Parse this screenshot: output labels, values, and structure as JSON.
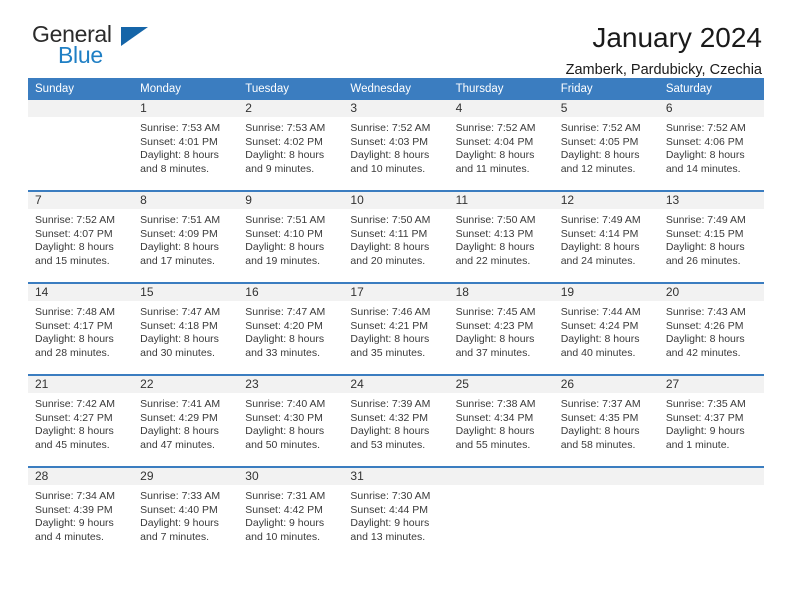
{
  "brand": {
    "name_part1": "General",
    "name_part2": "Blue",
    "accent_color": "#1f7fc4",
    "triangle_color": "#1565a8"
  },
  "header": {
    "title": "January 2024",
    "subtitle": "Zamberk, Pardubicky, Czechia"
  },
  "calendar": {
    "header_color": "#3b7dc0",
    "weekday_headers": [
      "Sunday",
      "Monday",
      "Tuesday",
      "Wednesday",
      "Thursday",
      "Friday",
      "Saturday"
    ],
    "weeks": [
      [
        {
          "day": "",
          "sunrise": "",
          "sunset": "",
          "daylight1": "",
          "daylight2": ""
        },
        {
          "day": "1",
          "sunrise": "Sunrise: 7:53 AM",
          "sunset": "Sunset: 4:01 PM",
          "daylight1": "Daylight: 8 hours",
          "daylight2": "and 8 minutes."
        },
        {
          "day": "2",
          "sunrise": "Sunrise: 7:53 AM",
          "sunset": "Sunset: 4:02 PM",
          "daylight1": "Daylight: 8 hours",
          "daylight2": "and 9 minutes."
        },
        {
          "day": "3",
          "sunrise": "Sunrise: 7:52 AM",
          "sunset": "Sunset: 4:03 PM",
          "daylight1": "Daylight: 8 hours",
          "daylight2": "and 10 minutes."
        },
        {
          "day": "4",
          "sunrise": "Sunrise: 7:52 AM",
          "sunset": "Sunset: 4:04 PM",
          "daylight1": "Daylight: 8 hours",
          "daylight2": "and 11 minutes."
        },
        {
          "day": "5",
          "sunrise": "Sunrise: 7:52 AM",
          "sunset": "Sunset: 4:05 PM",
          "daylight1": "Daylight: 8 hours",
          "daylight2": "and 12 minutes."
        },
        {
          "day": "6",
          "sunrise": "Sunrise: 7:52 AM",
          "sunset": "Sunset: 4:06 PM",
          "daylight1": "Daylight: 8 hours",
          "daylight2": "and 14 minutes."
        }
      ],
      [
        {
          "day": "7",
          "sunrise": "Sunrise: 7:52 AM",
          "sunset": "Sunset: 4:07 PM",
          "daylight1": "Daylight: 8 hours",
          "daylight2": "and 15 minutes."
        },
        {
          "day": "8",
          "sunrise": "Sunrise: 7:51 AM",
          "sunset": "Sunset: 4:09 PM",
          "daylight1": "Daylight: 8 hours",
          "daylight2": "and 17 minutes."
        },
        {
          "day": "9",
          "sunrise": "Sunrise: 7:51 AM",
          "sunset": "Sunset: 4:10 PM",
          "daylight1": "Daylight: 8 hours",
          "daylight2": "and 19 minutes."
        },
        {
          "day": "10",
          "sunrise": "Sunrise: 7:50 AM",
          "sunset": "Sunset: 4:11 PM",
          "daylight1": "Daylight: 8 hours",
          "daylight2": "and 20 minutes."
        },
        {
          "day": "11",
          "sunrise": "Sunrise: 7:50 AM",
          "sunset": "Sunset: 4:13 PM",
          "daylight1": "Daylight: 8 hours",
          "daylight2": "and 22 minutes."
        },
        {
          "day": "12",
          "sunrise": "Sunrise: 7:49 AM",
          "sunset": "Sunset: 4:14 PM",
          "daylight1": "Daylight: 8 hours",
          "daylight2": "and 24 minutes."
        },
        {
          "day": "13",
          "sunrise": "Sunrise: 7:49 AM",
          "sunset": "Sunset: 4:15 PM",
          "daylight1": "Daylight: 8 hours",
          "daylight2": "and 26 minutes."
        }
      ],
      [
        {
          "day": "14",
          "sunrise": "Sunrise: 7:48 AM",
          "sunset": "Sunset: 4:17 PM",
          "daylight1": "Daylight: 8 hours",
          "daylight2": "and 28 minutes."
        },
        {
          "day": "15",
          "sunrise": "Sunrise: 7:47 AM",
          "sunset": "Sunset: 4:18 PM",
          "daylight1": "Daylight: 8 hours",
          "daylight2": "and 30 minutes."
        },
        {
          "day": "16",
          "sunrise": "Sunrise: 7:47 AM",
          "sunset": "Sunset: 4:20 PM",
          "daylight1": "Daylight: 8 hours",
          "daylight2": "and 33 minutes."
        },
        {
          "day": "17",
          "sunrise": "Sunrise: 7:46 AM",
          "sunset": "Sunset: 4:21 PM",
          "daylight1": "Daylight: 8 hours",
          "daylight2": "and 35 minutes."
        },
        {
          "day": "18",
          "sunrise": "Sunrise: 7:45 AM",
          "sunset": "Sunset: 4:23 PM",
          "daylight1": "Daylight: 8 hours",
          "daylight2": "and 37 minutes."
        },
        {
          "day": "19",
          "sunrise": "Sunrise: 7:44 AM",
          "sunset": "Sunset: 4:24 PM",
          "daylight1": "Daylight: 8 hours",
          "daylight2": "and 40 minutes."
        },
        {
          "day": "20",
          "sunrise": "Sunrise: 7:43 AM",
          "sunset": "Sunset: 4:26 PM",
          "daylight1": "Daylight: 8 hours",
          "daylight2": "and 42 minutes."
        }
      ],
      [
        {
          "day": "21",
          "sunrise": "Sunrise: 7:42 AM",
          "sunset": "Sunset: 4:27 PM",
          "daylight1": "Daylight: 8 hours",
          "daylight2": "and 45 minutes."
        },
        {
          "day": "22",
          "sunrise": "Sunrise: 7:41 AM",
          "sunset": "Sunset: 4:29 PM",
          "daylight1": "Daylight: 8 hours",
          "daylight2": "and 47 minutes."
        },
        {
          "day": "23",
          "sunrise": "Sunrise: 7:40 AM",
          "sunset": "Sunset: 4:30 PM",
          "daylight1": "Daylight: 8 hours",
          "daylight2": "and 50 minutes."
        },
        {
          "day": "24",
          "sunrise": "Sunrise: 7:39 AM",
          "sunset": "Sunset: 4:32 PM",
          "daylight1": "Daylight: 8 hours",
          "daylight2": "and 53 minutes."
        },
        {
          "day": "25",
          "sunrise": "Sunrise: 7:38 AM",
          "sunset": "Sunset: 4:34 PM",
          "daylight1": "Daylight: 8 hours",
          "daylight2": "and 55 minutes."
        },
        {
          "day": "26",
          "sunrise": "Sunrise: 7:37 AM",
          "sunset": "Sunset: 4:35 PM",
          "daylight1": "Daylight: 8 hours",
          "daylight2": "and 58 minutes."
        },
        {
          "day": "27",
          "sunrise": "Sunrise: 7:35 AM",
          "sunset": "Sunset: 4:37 PM",
          "daylight1": "Daylight: 9 hours",
          "daylight2": "and 1 minute."
        }
      ],
      [
        {
          "day": "28",
          "sunrise": "Sunrise: 7:34 AM",
          "sunset": "Sunset: 4:39 PM",
          "daylight1": "Daylight: 9 hours",
          "daylight2": "and 4 minutes."
        },
        {
          "day": "29",
          "sunrise": "Sunrise: 7:33 AM",
          "sunset": "Sunset: 4:40 PM",
          "daylight1": "Daylight: 9 hours",
          "daylight2": "and 7 minutes."
        },
        {
          "day": "30",
          "sunrise": "Sunrise: 7:31 AM",
          "sunset": "Sunset: 4:42 PM",
          "daylight1": "Daylight: 9 hours",
          "daylight2": "and 10 minutes."
        },
        {
          "day": "31",
          "sunrise": "Sunrise: 7:30 AM",
          "sunset": "Sunset: 4:44 PM",
          "daylight1": "Daylight: 9 hours",
          "daylight2": "and 13 minutes."
        },
        {
          "day": "",
          "sunrise": "",
          "sunset": "",
          "daylight1": "",
          "daylight2": ""
        },
        {
          "day": "",
          "sunrise": "",
          "sunset": "",
          "daylight1": "",
          "daylight2": ""
        },
        {
          "day": "",
          "sunrise": "",
          "sunset": "",
          "daylight1": "",
          "daylight2": ""
        }
      ]
    ]
  }
}
